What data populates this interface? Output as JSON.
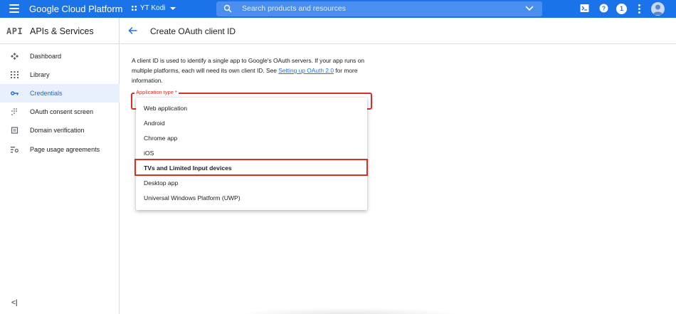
{
  "topbar": {
    "title": "Google Cloud Platform",
    "project": "YT Kodi",
    "search_placeholder": "Search products and resources",
    "notification_count": "1",
    "accent": "#1a73e8"
  },
  "sidebar": {
    "logo": "API",
    "title": "APIs & Services",
    "items": [
      {
        "label": "Dashboard",
        "icon": "dashboard-icon"
      },
      {
        "label": "Library",
        "icon": "library-icon"
      },
      {
        "label": "Credentials",
        "icon": "key-icon",
        "active": true
      },
      {
        "label": "OAuth consent screen",
        "icon": "consent-icon"
      },
      {
        "label": "Domain verification",
        "icon": "checkbox-icon"
      },
      {
        "label": "Page usage agreements",
        "icon": "settings-icon"
      }
    ],
    "collapse_label": "<|"
  },
  "main": {
    "title": "Create OAuth client ID",
    "description_part1": "A client ID is used to identify a single app to Google's OAuth servers. If your app runs on multiple platforms, each will need its own client ID. See ",
    "description_link": "Setting up OAuth 2.0",
    "description_part2": " for more information.",
    "field_label": "Application type *",
    "options": [
      "Web application",
      "Android",
      "Chrome app",
      "iOS",
      "TVs and Limited Input devices",
      "Desktop app",
      "Universal Windows Platform (UWP)"
    ],
    "highlighted_option": "TVs and Limited Input devices",
    "error_color": "#d93025"
  }
}
